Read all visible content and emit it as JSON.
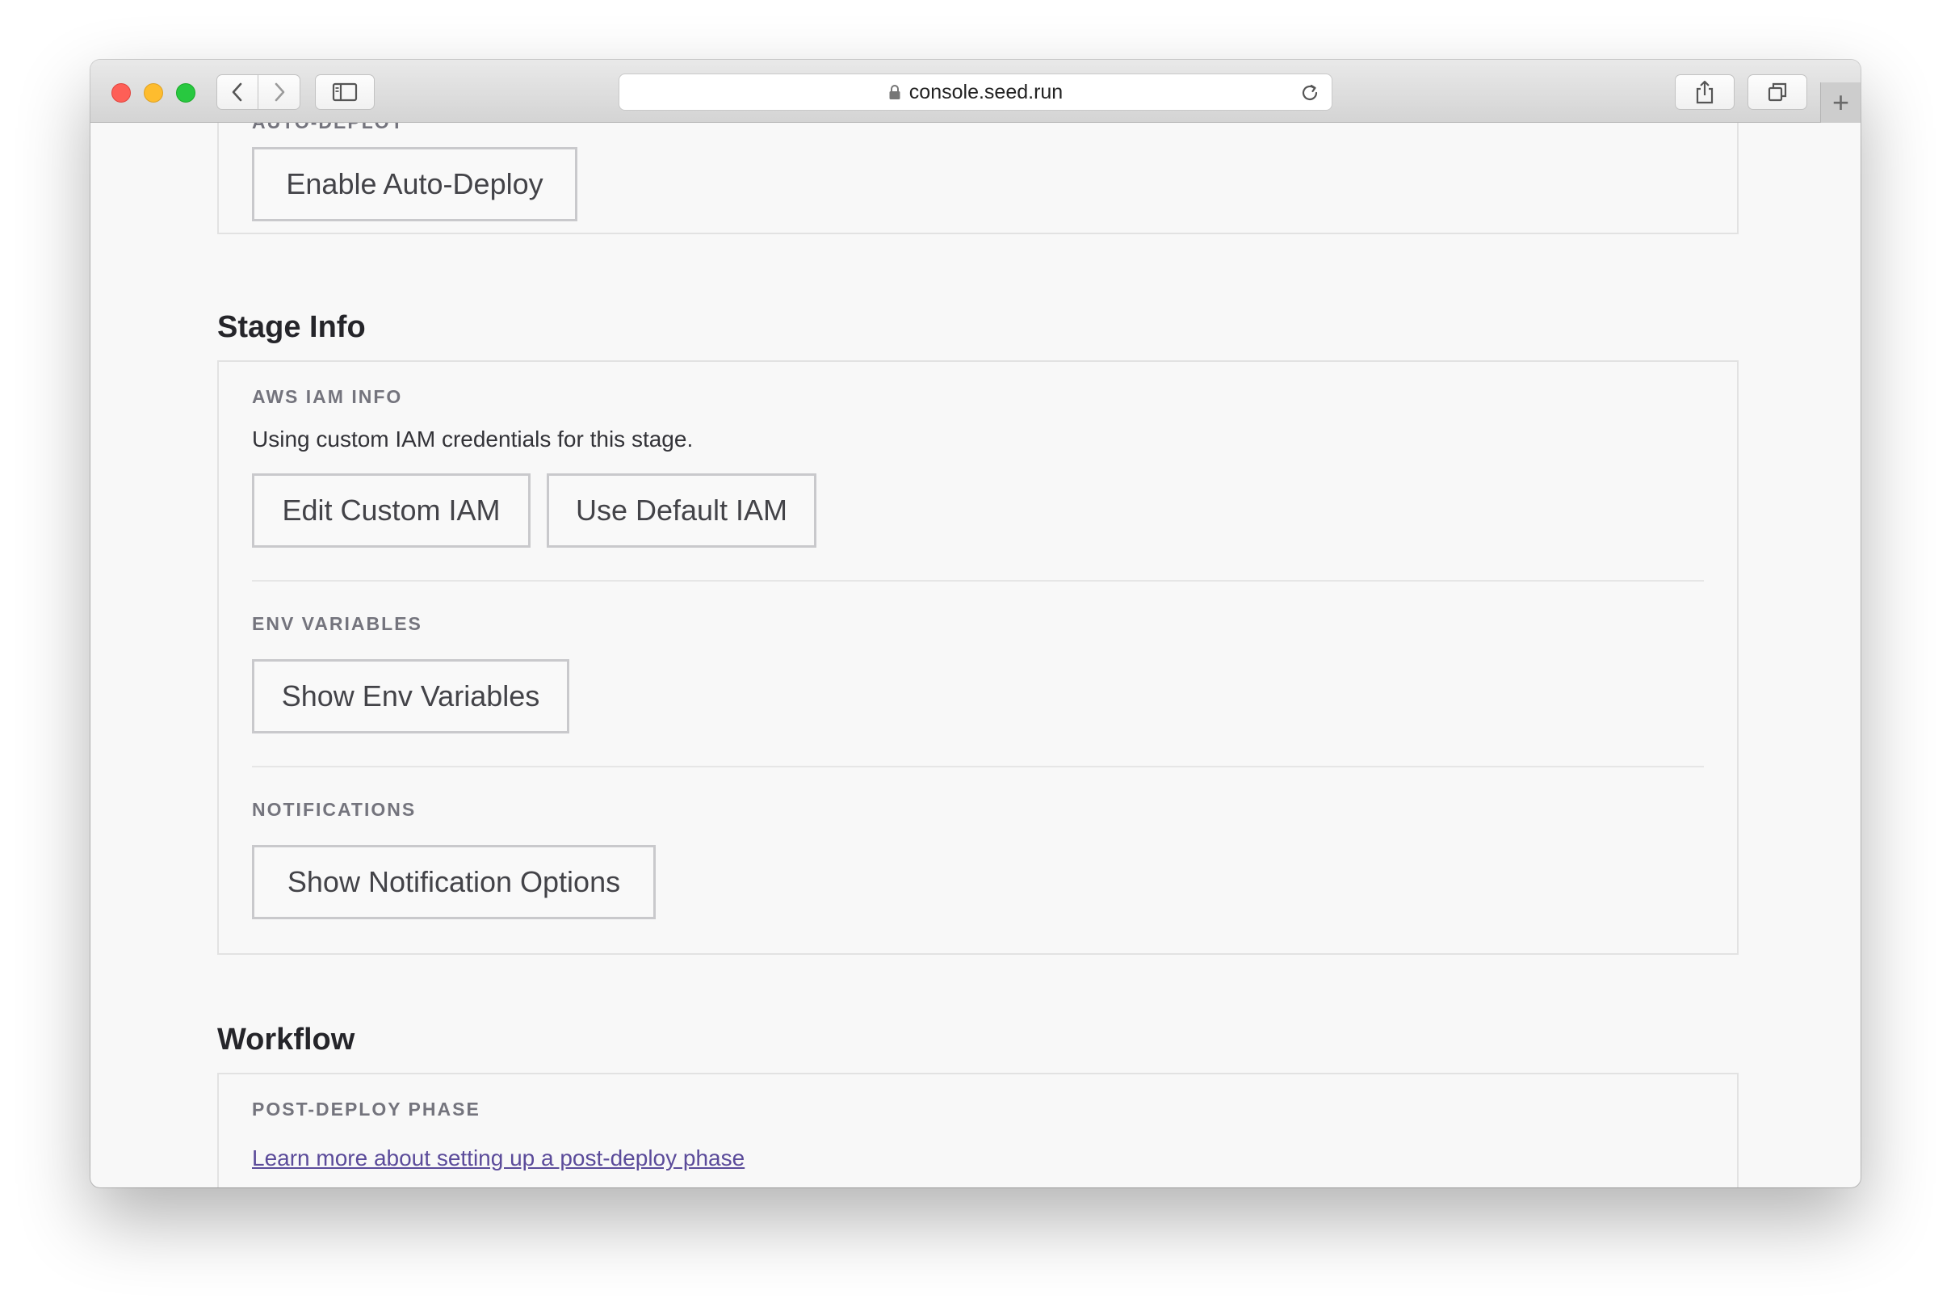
{
  "browser": {
    "url": "console.seed.run"
  },
  "auto_deploy": {
    "label": "AUTO-DEPLOY",
    "button": "Enable Auto-Deploy"
  },
  "stage_info": {
    "heading": "Stage Info",
    "aws_iam": {
      "label": "AWS IAM INFO",
      "description": "Using custom IAM credentials for this stage.",
      "edit_button": "Edit Custom IAM",
      "default_button": "Use Default IAM"
    },
    "env_variables": {
      "label": "ENV VARIABLES",
      "button": "Show Env Variables"
    },
    "notifications": {
      "label": "NOTIFICATIONS",
      "button": "Show Notification Options"
    }
  },
  "workflow": {
    "heading": "Workflow",
    "post_deploy": {
      "label": "POST-DEPLOY PHASE",
      "link": "Learn more about setting up a post-deploy phase"
    }
  },
  "colors": {
    "link": "#5b4b9a",
    "label": "#74747d",
    "button_border": "#c9c9cc"
  }
}
